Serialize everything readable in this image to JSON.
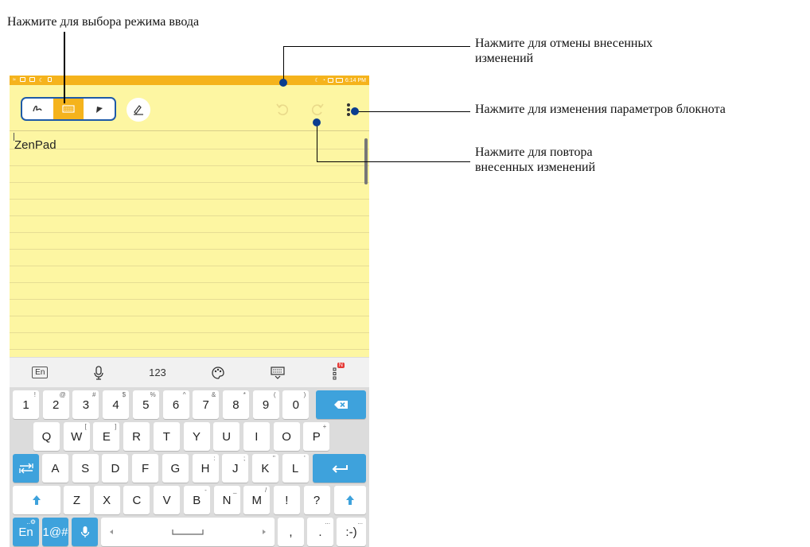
{
  "callouts": {
    "input_mode": "Нажмите для выбора режима ввода",
    "undo_line1": "Нажмите для отмены внесенных",
    "undo_line2": "изменений",
    "settings": "Нажмите для изменения параметров блокнота",
    "redo_line1": "Нажмите для повтора",
    "redo_line2": "внесенных изменений"
  },
  "status_bar": {
    "time": "6:14 PM"
  },
  "note": {
    "text": "ZenPad"
  },
  "keyboard_toolbar": {
    "lang": "En",
    "numbers": "123",
    "badge": "N"
  },
  "keyboard": {
    "row1": [
      {
        "k": "1",
        "s": "!"
      },
      {
        "k": "2",
        "s": "@"
      },
      {
        "k": "3",
        "s": "#"
      },
      {
        "k": "4",
        "s": "$"
      },
      {
        "k": "5",
        "s": "%"
      },
      {
        "k": "6",
        "s": "^"
      },
      {
        "k": "7",
        "s": "&"
      },
      {
        "k": "8",
        "s": "*"
      },
      {
        "k": "9",
        "s": "("
      },
      {
        "k": "0",
        "s": ")"
      }
    ],
    "row2": [
      {
        "k": "Q",
        "s": ""
      },
      {
        "k": "W",
        "s": "["
      },
      {
        "k": "E",
        "s": "]"
      },
      {
        "k": "R",
        "s": ""
      },
      {
        "k": "T",
        "s": ""
      },
      {
        "k": "Y",
        "s": ""
      },
      {
        "k": "U",
        "s": ""
      },
      {
        "k": "I",
        "s": ""
      },
      {
        "k": "O",
        "s": ""
      },
      {
        "k": "P",
        "s": "+"
      }
    ],
    "row3": [
      {
        "k": "A",
        "s": ""
      },
      {
        "k": "S",
        "s": ""
      },
      {
        "k": "D",
        "s": ""
      },
      {
        "k": "F",
        "s": ""
      },
      {
        "k": "G",
        "s": ""
      },
      {
        "k": "H",
        "s": ":"
      },
      {
        "k": "J",
        "s": ";"
      },
      {
        "k": "K",
        "s": "\""
      },
      {
        "k": "L",
        "s": "'"
      }
    ],
    "row4": [
      {
        "k": "Z",
        "s": ""
      },
      {
        "k": "X",
        "s": ""
      },
      {
        "k": "C",
        "s": ""
      },
      {
        "k": "V",
        "s": ""
      },
      {
        "k": "B",
        "s": "-"
      },
      {
        "k": "N",
        "s": "_"
      },
      {
        "k": "M",
        "s": "/"
      },
      {
        "k": "!",
        "s": ""
      },
      {
        "k": "?",
        "s": ""
      }
    ],
    "row5": {
      "lang": "En",
      "lang_sup": "..⚙",
      "sym": "1@#",
      "comma": ",",
      "period": ".",
      "period_sup": "...",
      "smiley": ":-)",
      "smiley_sup": "..."
    }
  },
  "colors": {
    "accent": "#f5b31c",
    "key_blue": "#3ea2dc",
    "pad": "#fdf6a2",
    "callout_dot": "#0a3d8f"
  },
  "icons": [
    "handwriting-icon",
    "keyboard-icon",
    "stylus-icon",
    "pen-settings-icon",
    "undo-icon",
    "redo-icon",
    "more-vert-icon",
    "mic-icon",
    "palette-icon",
    "keyboard-hide-icon",
    "backspace-icon",
    "tab-icon",
    "enter-icon",
    "shift-icon"
  ]
}
